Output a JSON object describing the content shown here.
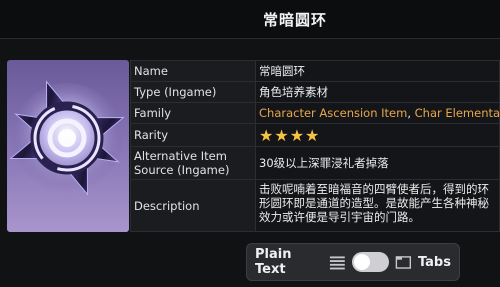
{
  "header": {
    "title": "常暗圆环"
  },
  "item": {
    "icon": "purple-ring-relic-icon",
    "rows": [
      {
        "label": "Name",
        "value": "常暗圆环"
      },
      {
        "label": "Type (Ingame)",
        "value": "角色培养素材"
      },
      {
        "label": "Family",
        "links": [
          "Character Ascension Item",
          "Char Elementa"
        ],
        "separator": ", "
      },
      {
        "label": "Rarity",
        "stars": "★★★★",
        "rating": 4
      },
      {
        "label": "Alternative Item Source (Ingame)",
        "value": "30级以上深罪浸礼者掉落"
      },
      {
        "label": "Description",
        "value": "击败呢喃着至暗福音的四臂使者后，得到的环形圆环即是通道的造型。是故能产生各种神秘效力或许便是导引宇宙的门路。"
      }
    ]
  },
  "toggle": {
    "plain_label": "Plain Text",
    "tabs_label": "Tabs",
    "state": "plain",
    "list_icon": "list-icon",
    "tabs_icon": "browser-tab-icon"
  },
  "colors": {
    "accent": "#e7a74a",
    "star": "#f5c542"
  }
}
